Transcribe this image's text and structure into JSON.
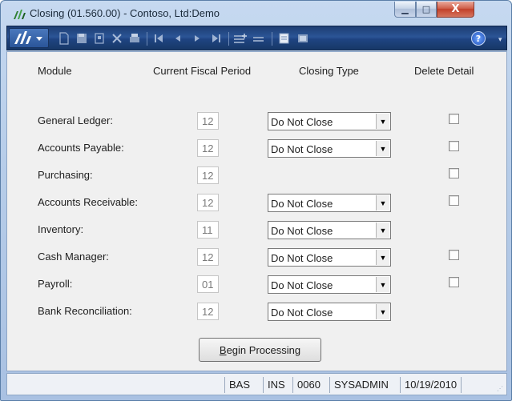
{
  "window": {
    "title": "Closing (01.560.00) - Contoso, Ltd:Demo",
    "min_glyph": "▁",
    "max_glyph": "□",
    "close_glyph": "X"
  },
  "toolbar": {
    "icons": [
      "new-icon",
      "save-icon",
      "copy-icon",
      "delete-icon",
      "print-icon",
      "first-record-icon",
      "previous-record-icon",
      "next-record-icon",
      "last-record-icon",
      "insert-row-icon",
      "delete-row-icon",
      "notes-icon",
      "attach-icon",
      "help-icon"
    ],
    "help_glyph": "?"
  },
  "headers": {
    "module": "Module",
    "period": "Current Fiscal Period",
    "closing_type": "Closing Type",
    "delete_detail": "Delete Detail"
  },
  "rows": [
    {
      "label": "General Ledger:",
      "period": "12",
      "closing": "Do Not Close",
      "has_select": true,
      "has_checkbox": true,
      "checked": false
    },
    {
      "label": "Accounts Payable:",
      "period": "12",
      "closing": "Do Not Close",
      "has_select": true,
      "has_checkbox": true,
      "checked": false
    },
    {
      "label": "Purchasing:",
      "period": "12",
      "closing": "",
      "has_select": false,
      "has_checkbox": true,
      "checked": false
    },
    {
      "label": "Accounts Receivable:",
      "period": "12",
      "closing": "Do Not Close",
      "has_select": true,
      "has_checkbox": true,
      "checked": false
    },
    {
      "label": "Inventory:",
      "period": "11",
      "closing": "Do Not Close",
      "has_select": true,
      "has_checkbox": false,
      "checked": false
    },
    {
      "label": "Cash Manager:",
      "period": "12",
      "closing": "Do Not Close",
      "has_select": true,
      "has_checkbox": true,
      "checked": false
    },
    {
      "label": "Payroll:",
      "period": "01",
      "closing": "Do Not Close",
      "has_select": true,
      "has_checkbox": true,
      "checked": false
    },
    {
      "label": "Bank Reconciliation:",
      "period": "12",
      "closing": "Do Not Close",
      "has_select": true,
      "has_checkbox": false,
      "checked": false
    }
  ],
  "begin_button": {
    "label_underlined": "B",
    "label_rest": "egin Processing"
  },
  "statusbar": {
    "mode": "BAS",
    "insert": "INS",
    "company": "0060",
    "user": "SYSADMIN",
    "date": "10/19/2010"
  }
}
